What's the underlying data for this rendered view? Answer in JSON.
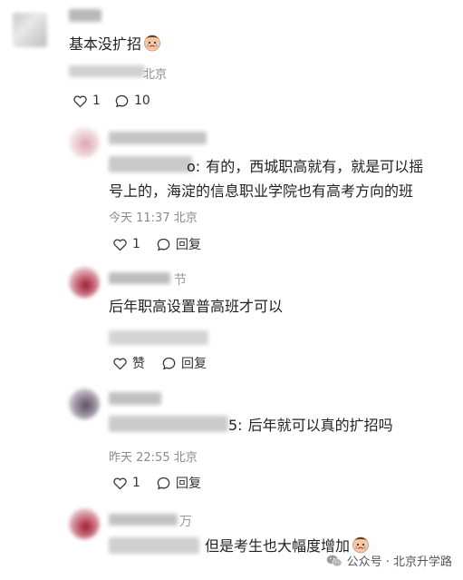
{
  "comments": [
    {
      "id": "c1",
      "name_suffix": "",
      "text": "基本没扩招",
      "location": "北京",
      "time": "",
      "likes": "1",
      "replies": "10"
    },
    {
      "id": "c2",
      "reply_prefix_suffix": "o:",
      "text_line1": "有的，西城职高就有，就是可以摇",
      "text_line2": "号上的，海淀的信息职业学院也有高考方向的班",
      "time": "今天 11:37",
      "location": "北京",
      "likes": "1",
      "reply_label": "回复"
    },
    {
      "id": "c3",
      "name_suffix": "节",
      "text": "后年职高设置普高班才可以",
      "like_label": "赞",
      "reply_label": "回复"
    },
    {
      "id": "c4",
      "reply_prefix_suffix": "5:",
      "text": "后年就可以真的扩招吗",
      "time": "昨天 22:55",
      "location": "北京",
      "likes": "1",
      "reply_label": "回复"
    },
    {
      "id": "c5",
      "name_suffix": "万",
      "text": "但是考生也大幅度增加"
    }
  ],
  "watermark": {
    "text": "公众号 · 北京升学路"
  }
}
